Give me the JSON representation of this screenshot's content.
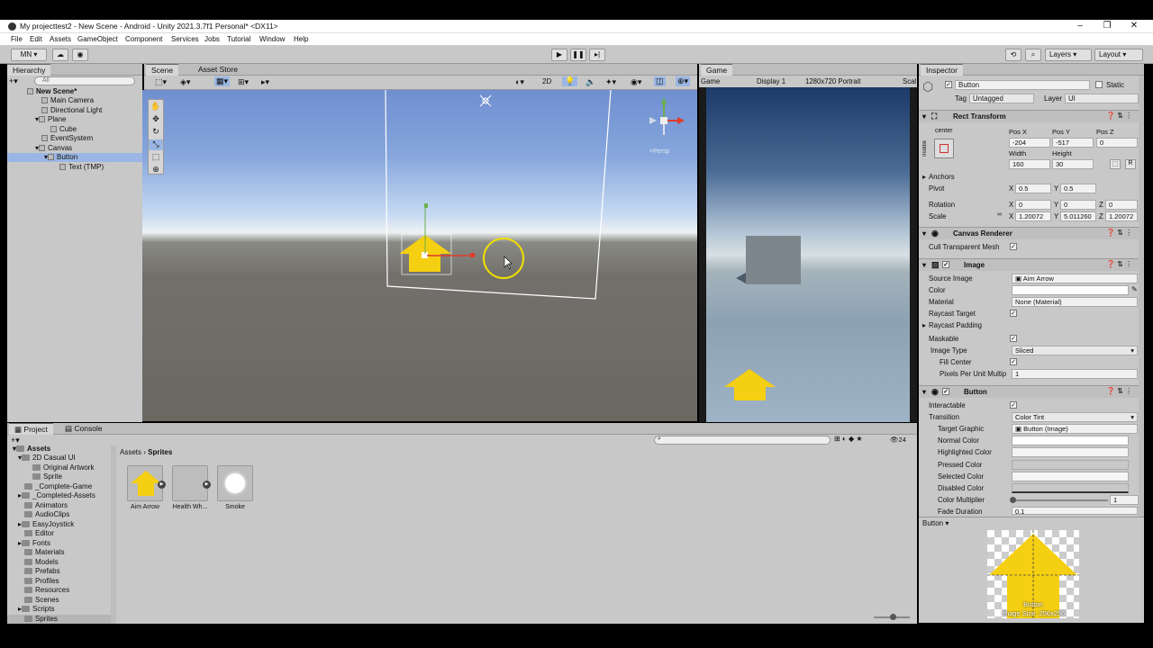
{
  "window": {
    "title": "My projecttest2 - New Scene - Android - Unity 2021.3.7f1 Personal* <DX11>",
    "minimize": "–",
    "maximize": "❐",
    "close": "✕"
  },
  "menu": [
    "File",
    "Edit",
    "Assets",
    "GameObject",
    "Component",
    "Services",
    "Jobs",
    "Tutorial",
    "Window",
    "Help"
  ],
  "toolbar": {
    "account": "MN ▾",
    "layers": "Layers",
    "layout": "Layout"
  },
  "hierarchy": {
    "tab": "Hierarchy",
    "search_placeholder": "All",
    "items": [
      {
        "label": "New Scene*",
        "depth": 0
      },
      {
        "label": "Main Camera",
        "depth": 1
      },
      {
        "label": "Directional Light",
        "depth": 1
      },
      {
        "label": "Plane",
        "depth": 1
      },
      {
        "label": "Cube",
        "depth": 2
      },
      {
        "label": "EventSystem",
        "depth": 1
      },
      {
        "label": "Canvas",
        "depth": 1
      },
      {
        "label": "Button",
        "depth": 2
      },
      {
        "label": "Text (TMP)",
        "depth": 3
      }
    ]
  },
  "scene": {
    "tab": "Scene",
    "tab2": "Asset Store",
    "mode2d": "2D",
    "persp": "<Persp"
  },
  "game": {
    "tab": "Game",
    "display_dropdown": "Game",
    "display": "Display 1",
    "resolution": "1280x720 Portrait",
    "scale": "Scal"
  },
  "inspector": {
    "tab": "Inspector",
    "object_name": "Button",
    "static_label": "Static",
    "tag_label": "Tag",
    "tag_value": "Untagged",
    "layer_label": "Layer",
    "layer_value": "UI",
    "rect_transform": {
      "header": "Rect Transform",
      "anchor_label": "center",
      "anchor_side": "middle",
      "posx_label": "Pos X",
      "posy_label": "Pos Y",
      "posz_label": "Pos Z",
      "posx": "-204",
      "posy": "-517",
      "posz": "0",
      "width_label": "Width",
      "height_label": "Height",
      "width": "160",
      "height": "30",
      "anchors": "Anchors",
      "pivot_label": "Pivot",
      "pivot_x": "0.5",
      "pivot_y": "0.5",
      "rotation_label": "Rotation",
      "rot_x": "0",
      "rot_y": "0",
      "rot_z": "0",
      "scale_label": "Scale",
      "scale_x": "1.20072",
      "scale_y": "5.011260",
      "scale_z": "1.20072",
      "x": "X",
      "y": "Y",
      "z": "Z",
      "r": "R"
    },
    "canvas_renderer": {
      "header": "Canvas Renderer",
      "cull_label": "Cull Transparent Mesh"
    },
    "image": {
      "header": "Image",
      "source_image_label": "Source Image",
      "source_image": "Aim Arrow",
      "color_label": "Color",
      "material_label": "Material",
      "material": "None (Material)",
      "raycast_target": "Raycast Target",
      "raycast_padding": "Raycast Padding",
      "maskable": "Maskable",
      "image_type_label": "Image Type",
      "image_type": "Sliced",
      "fill_center": "Fill Center",
      "ppu_label": "Pixels Per Unit Multip",
      "ppu": "1"
    },
    "button": {
      "header": "Button",
      "interactable": "Interactable",
      "transition_label": "Transition",
      "transition": "Color Tint",
      "target_graphic_label": "Target Graphic",
      "target_graphic": "Button (Image)",
      "normal": "Normal Color",
      "highlighted": "Highlighted Color",
      "pressed": "Pressed Color",
      "selected": "Selected Color",
      "disabled": "Disabled Color",
      "multiplier_label": "Color Multiplier",
      "multiplier": "1",
      "fade_label": "Fade Duration",
      "fade": "0.1"
    },
    "preview": {
      "dropdown": "Button ▾",
      "name": "Button",
      "size": "Image Size: 256x256"
    }
  },
  "project": {
    "tab": "Project",
    "tab2": "Console",
    "count": "24",
    "breadcrumb_root": "Assets",
    "breadcrumb_leaf": "Sprites",
    "tree": [
      {
        "label": "Assets",
        "depth": 0
      },
      {
        "label": "2D Casual UI",
        "depth": 1
      },
      {
        "label": "Original Artwork",
        "depth": 2
      },
      {
        "label": "Sprite",
        "depth": 2
      },
      {
        "label": "_Complete-Game",
        "depth": 1
      },
      {
        "label": "_Completed-Assets",
        "depth": 1
      },
      {
        "label": "Animators",
        "depth": 1
      },
      {
        "label": "AudioClips",
        "depth": 1
      },
      {
        "label": "EasyJoystick",
        "depth": 1
      },
      {
        "label": "Editor",
        "depth": 1
      },
      {
        "label": "Fonts",
        "depth": 1
      },
      {
        "label": "Materials",
        "depth": 1
      },
      {
        "label": "Models",
        "depth": 1
      },
      {
        "label": "Prefabs",
        "depth": 1
      },
      {
        "label": "Profiles",
        "depth": 1
      },
      {
        "label": "Resources",
        "depth": 1
      },
      {
        "label": "Scenes",
        "depth": 1
      },
      {
        "label": "Scripts",
        "depth": 1
      },
      {
        "label": "Sprites",
        "depth": 1
      }
    ],
    "assets": [
      {
        "label": "Aim Arrow",
        "kind": "arrow"
      },
      {
        "label": "Health Wh...",
        "kind": "blank"
      },
      {
        "label": "Smoke",
        "kind": "circle"
      }
    ]
  },
  "colors": {
    "accent": "#3a72c4",
    "arrow_yellow": "#f4cf12",
    "selection": "#9bb6e3"
  }
}
